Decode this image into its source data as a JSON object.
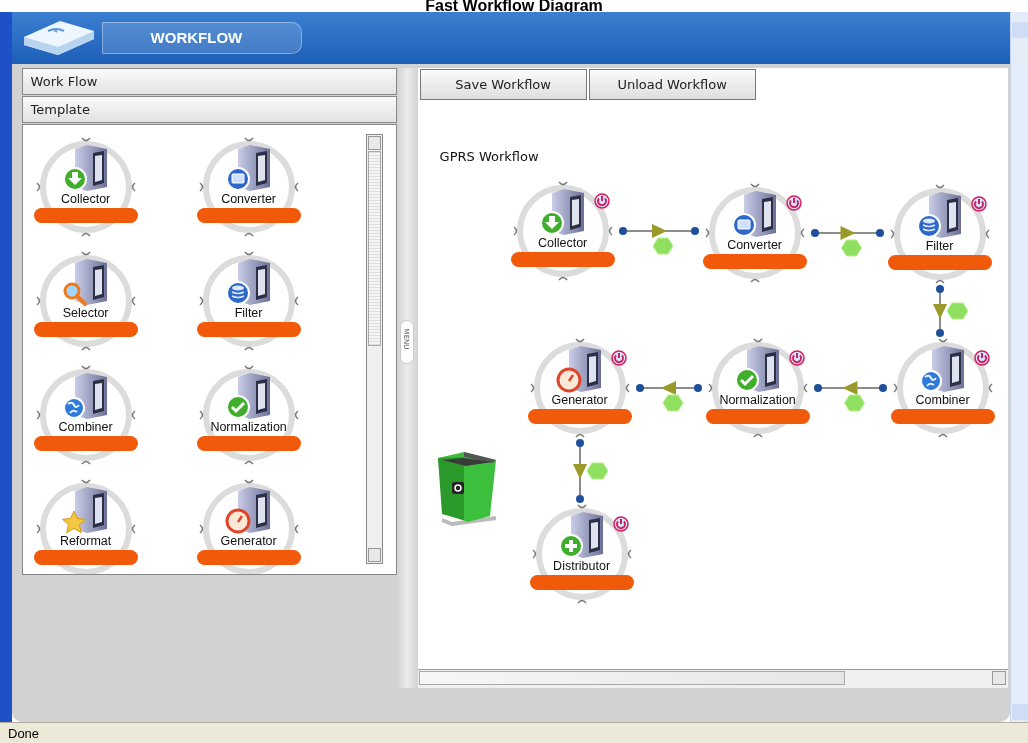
{
  "page_title": "Fast Workflow Diagram",
  "app": {
    "title": "WORKFLOW"
  },
  "accordion": [
    "Work Flow",
    "Template"
  ],
  "palette": [
    {
      "label": "Collector",
      "kind": "download"
    },
    {
      "label": "Converter",
      "kind": "monitor"
    },
    {
      "label": "Selector",
      "kind": "magnifier"
    },
    {
      "label": "Filter",
      "kind": "database"
    },
    {
      "label": "Combiner",
      "kind": "globe"
    },
    {
      "label": "Normalization",
      "kind": "check"
    },
    {
      "label": "Reformat",
      "kind": "star"
    },
    {
      "label": "Generator",
      "kind": "gauge"
    }
  ],
  "splitter": {
    "label": "MENU"
  },
  "toolbar": [
    "Save Workflow",
    "Unload Workflow"
  ],
  "canvas": {
    "title": "GPRS Workflow",
    "nodes": [
      {
        "label": "Collector",
        "kind": "download"
      },
      {
        "label": "Converter",
        "kind": "monitor"
      },
      {
        "label": "Filter",
        "kind": "database"
      },
      {
        "label": "Generator",
        "kind": "gauge"
      },
      {
        "label": "Normalization",
        "kind": "check"
      },
      {
        "label": "Combiner",
        "kind": "globe"
      },
      {
        "label": "Distributor",
        "kind": "plus"
      }
    ]
  },
  "status_bar": "Done"
}
